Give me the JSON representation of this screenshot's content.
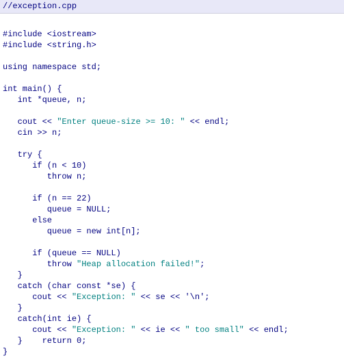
{
  "header": {
    "comment": "//exception.cpp"
  },
  "code": {
    "l01": "#include <iostream>",
    "l02": "#include <string.h>",
    "l03": "",
    "l04": "using namespace std;",
    "l05": "",
    "l06": "int main() {",
    "l07": "   int *queue, n;",
    "l08": "",
    "l09a": "   cout << ",
    "l09s": "\"Enter queue-size >= 10: \"",
    "l09b": " << endl;",
    "l10": "   cin >> n;",
    "l11": "",
    "l12": "   try {",
    "l13": "      if (n < 10)",
    "l14": "         throw n;",
    "l15": "",
    "l16": "      if (n == 22)",
    "l17": "         queue = NULL;",
    "l18": "      else",
    "l19": "         queue = new int[n];",
    "l20": "",
    "l21": "      if (queue == NULL)",
    "l22a": "         throw ",
    "l22s": "\"Heap allocation failed!\"",
    "l22b": ";",
    "l23": "   }",
    "l24": "   catch (char const *se) {",
    "l25a": "      cout << ",
    "l25s": "\"Exception: \"",
    "l25b": " << se << '\\n';",
    "l26": "   }",
    "l27": "   catch(int ie) {",
    "l28a": "      cout << ",
    "l28s1": "\"Exception: \"",
    "l28b": " << ie << ",
    "l28s2": "\" too small\"",
    "l28c": " << endl;",
    "l29": "   }    return 0;",
    "l30": "}"
  }
}
